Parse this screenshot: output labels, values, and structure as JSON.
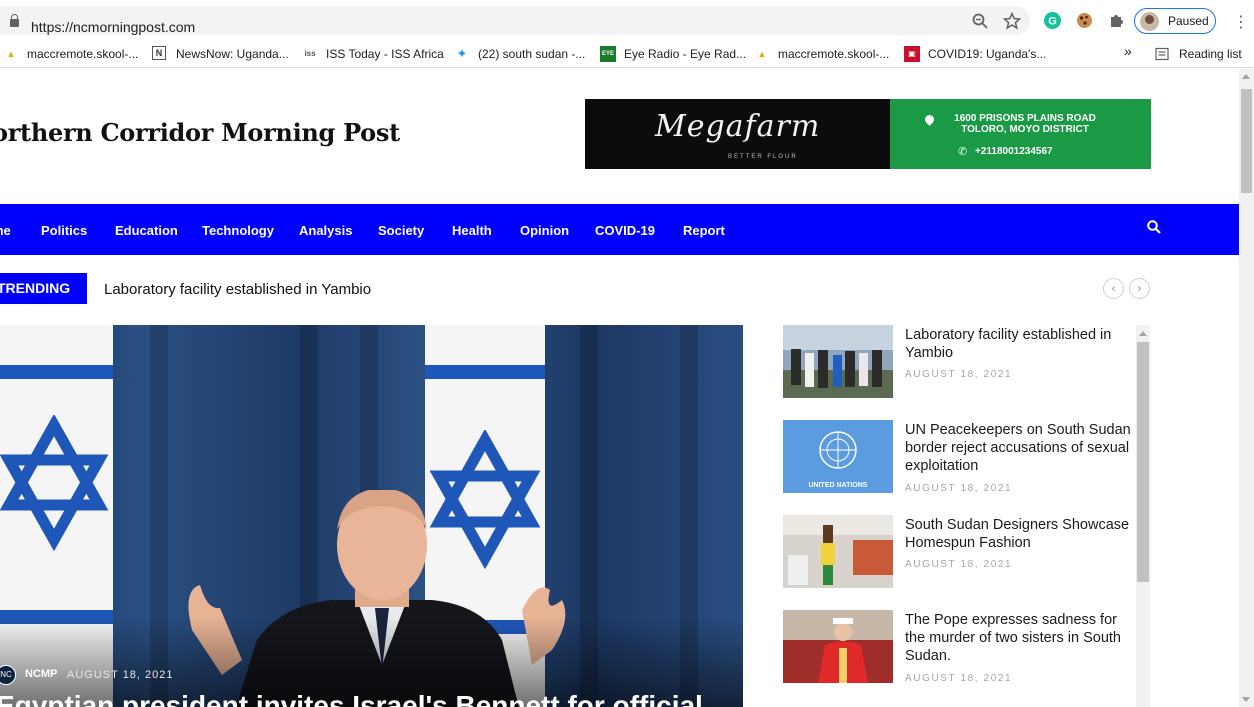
{
  "browser": {
    "url": "https://ncmorningpost.com",
    "profile_label": "Paused",
    "bookmarks": [
      {
        "label": "maccremote.skool-...",
        "icon": "PMA"
      },
      {
        "label": "NewsNow: Uganda...",
        "icon": "N"
      },
      {
        "label": "ISS Today - ISS Africa",
        "icon": "iss"
      },
      {
        "label": "(22) south sudan -...",
        "icon": "twitter"
      },
      {
        "label": "Eye Radio - Eye Rad...",
        "icon": "eye"
      },
      {
        "label": "maccremote.skool-...",
        "icon": "PMA"
      },
      {
        "label": "COVID19: Uganda's...",
        "icon": "covid"
      }
    ],
    "overflow": "»",
    "reading_list": "Reading list"
  },
  "site": {
    "logo": "orthern Corridor Morning Post",
    "ad": {
      "brand": "Megafarm",
      "tagline": "BETTER FLOUR",
      "address_line1": "1600 PRISONS PLAINS ROAD",
      "address_line2": "TOLORO, MOYO DISTRICT",
      "phone": "+2118001234567"
    },
    "nav": [
      "me",
      "Politics",
      "Education",
      "Technology",
      "Analysis",
      "Society",
      "Health",
      "Opinion",
      "COVID-19",
      "Report"
    ],
    "trending": {
      "label": "TRENDING",
      "text": "Laboratory facility established in Yambio",
      "prev": "‹",
      "next": "›"
    },
    "hero": {
      "author_badge": "NC",
      "author": "NCMP",
      "date": "AUGUST 18, 2021",
      "headline": "Egyptian president invites Israel's Bennett for official"
    },
    "sidebar_posts": [
      {
        "title": "Laboratory facility established in Yambio",
        "date": "AUGUST 18, 2021"
      },
      {
        "title": "UN Peacekeepers on South Sudan border reject accusations of sexual exploitation",
        "date": "AUGUST 18, 2021",
        "thumb_text": "UNITED NATIONS"
      },
      {
        "title": "South Sudan Designers Showcase Homespun Fashion",
        "date": "AUGUST 18, 2021"
      },
      {
        "title": "The Pope expresses sadness for the murder of two sisters in South Sudan.",
        "date": "AUGUST 18, 2021"
      }
    ]
  },
  "colors": {
    "nav_blue": "#0000ff",
    "ad_green": "#1a9a45",
    "chrome_accent": "#1a73e8"
  }
}
